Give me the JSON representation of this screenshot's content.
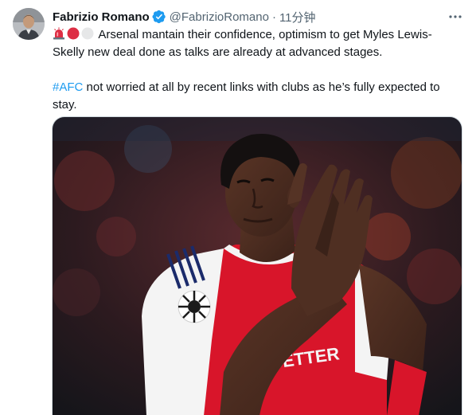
{
  "tweet": {
    "author_name": "Fabrizio Romano",
    "author_handle": "@FabrizioRomano",
    "separator": "·",
    "timestamp": "11分钟",
    "line1": " Arsenal mantain their confidence, optimism to get Myles Lewis-Skelly new deal done as talks are already at advanced stages.",
    "hashtag": "#AFC",
    "line2": " not worried at all by recent links with clubs as he’s fully expected to stay.",
    "emojis": [
      "siren-emoji",
      "red-circle-emoji",
      "white-circle-emoji"
    ]
  },
  "photo": {
    "shirt_text": "Emirates FLY BETTER",
    "colors": {
      "arsenal_red": "#d8152a",
      "white": "#f4f4f4",
      "navy": "#1b2b6b"
    }
  },
  "colors": {
    "link": "#1d9bf0",
    "secondary_text": "#536471",
    "verified": "#1d9bf0"
  }
}
